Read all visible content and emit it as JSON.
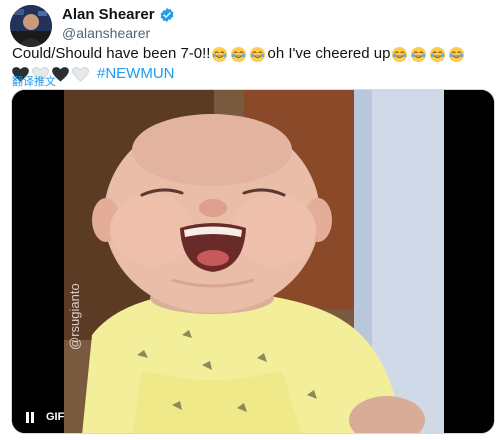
{
  "author": {
    "display_name": "Alan Shearer",
    "handle": "@alanshearer",
    "verified": true,
    "avatar_icon": "profile-photo"
  },
  "tweet": {
    "text_part1": "Could/Should have been 7-0!! ",
    "text_part2": " oh I've cheered up ",
    "emoji_laugh_count_1": 3,
    "emoji_laugh_count_2": 4,
    "hearts": [
      "black",
      "white",
      "black",
      "white"
    ],
    "hashtag": "#NEWMUN",
    "translate_label": "翻译推文"
  },
  "media": {
    "type": "GIF",
    "watermark": "@rsugianto",
    "pause_icon": "pause-icon",
    "badge": "GIF"
  },
  "colors": {
    "accent": "#1d9bf0",
    "text": "#0f1419",
    "secondary_text": "#536471"
  }
}
